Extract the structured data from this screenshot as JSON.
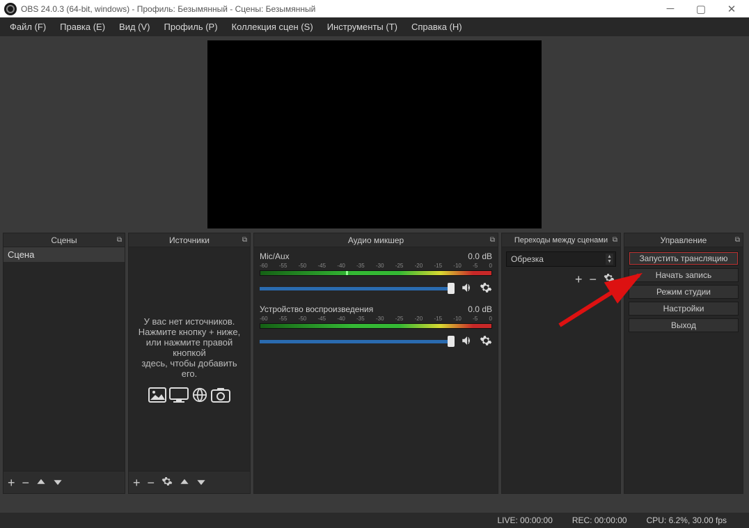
{
  "window": {
    "title": "OBS 24.0.3 (64-bit, windows) - Профиль: Безымянный - Сцены: Безымянный"
  },
  "menu": {
    "file": "Файл (F)",
    "edit": "Правка (E)",
    "view": "Вид (V)",
    "profile": "Профиль (P)",
    "scene_collection": "Коллекция сцен (S)",
    "tools": "Инструменты (T)",
    "help": "Справка (H)"
  },
  "docks": {
    "scenes_title": "Сцены",
    "sources_title": "Источники",
    "mixer_title": "Аудио микшер",
    "transitions_title": "Переходы между сценами",
    "controls_title": "Управление"
  },
  "scenes": {
    "items": [
      "Сцена"
    ]
  },
  "sources": {
    "empty_line1": "У вас нет источников.",
    "empty_line2": "Нажмите кнопку + ниже,",
    "empty_line3": "или нажмите правой кнопкой",
    "empty_line4": "здесь, чтобы добавить его."
  },
  "mixer": {
    "channels": [
      {
        "name": "Mic/Aux",
        "level": "0.0 dB"
      },
      {
        "name": "Устройство воспроизведения",
        "level": "0.0 dB"
      }
    ],
    "ticks": [
      "-60",
      "-55",
      "-50",
      "-45",
      "-40",
      "-35",
      "-30",
      "-25",
      "-20",
      "-15",
      "-10",
      "-5",
      "0"
    ]
  },
  "transitions": {
    "selected": "Обрезка"
  },
  "controls": {
    "start_stream": "Запустить трансляцию",
    "start_record": "Начать запись",
    "studio_mode": "Режим студии",
    "settings": "Настройки",
    "exit": "Выход"
  },
  "status": {
    "live": "LIVE: 00:00:00",
    "rec": "REC: 00:00:00",
    "cpu": "CPU: 6.2%, 30.00 fps"
  }
}
